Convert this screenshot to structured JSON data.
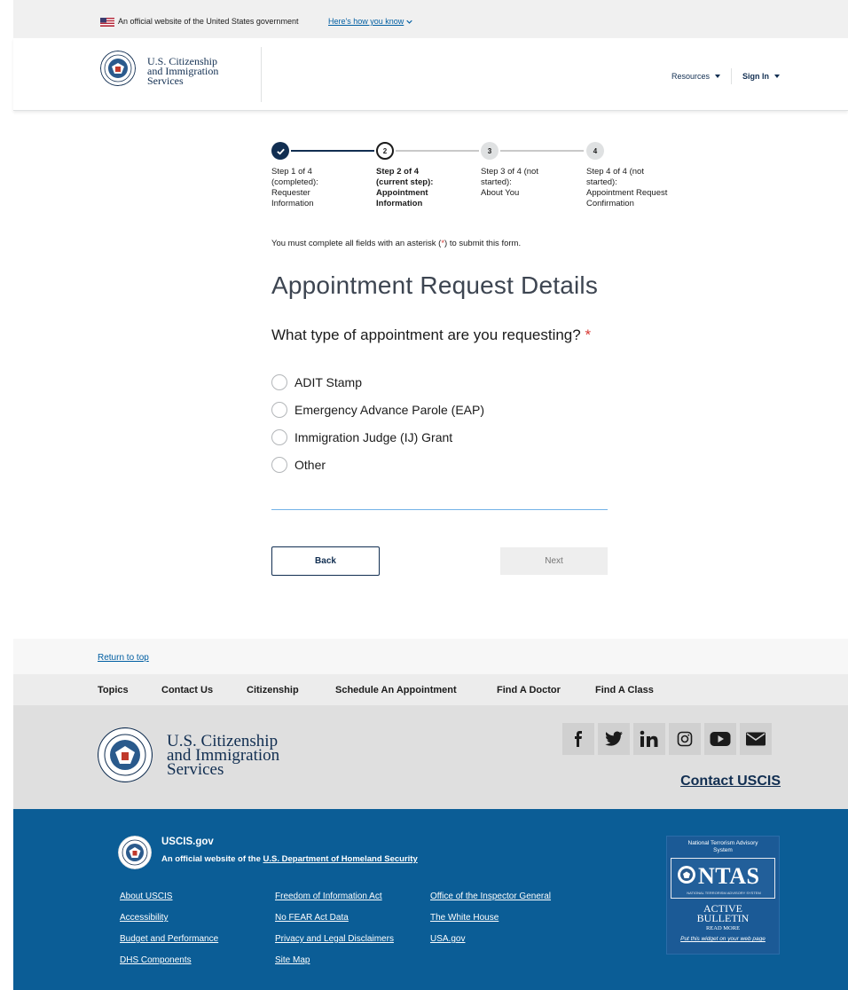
{
  "gov_banner": {
    "text": "An official website of the United States government",
    "link": "Here's how you know"
  },
  "header": {
    "agency_name_line1": "U.S. Citizenship",
    "agency_name_line2": "and Immigration",
    "agency_name_line3": "Services",
    "nav": {
      "resources": "Resources",
      "sign_in": "Sign In"
    }
  },
  "stepper": {
    "steps": [
      {
        "number": "1",
        "line1": "Step 1 of 4",
        "line2": "(completed):",
        "line3": "Requester",
        "line4": "Information",
        "state": "completed"
      },
      {
        "number": "2",
        "line1": "Step 2 of 4",
        "line2": "(current step):",
        "line3": "Appointment",
        "line4": "Information",
        "state": "current"
      },
      {
        "number": "3",
        "line1": "Step 3 of 4 (not",
        "line2": "started):",
        "line3": "About You",
        "line4": "",
        "state": "not-started"
      },
      {
        "number": "4",
        "line1": "Step 4 of 4 (not",
        "line2": "started):",
        "line3": "Appointment Request",
        "line4": "Confirmation",
        "state": "not-started"
      }
    ]
  },
  "form": {
    "required_note_before": "You must complete all fields with an asterisk (",
    "required_note_asterisk": "*",
    "required_note_after": ") to submit this form.",
    "title": "Appointment Request Details",
    "question": "What type of appointment are you requesting?",
    "question_asterisk": "*",
    "options": [
      "ADIT Stamp",
      "Emergency Advance Parole (EAP)",
      "Immigration Judge (IJ) Grant",
      "Other"
    ],
    "back_label": "Back",
    "next_label": "Next"
  },
  "footer": {
    "return_to_top": "Return to top",
    "topics": [
      "Topics",
      "Contact Us",
      "Citizenship",
      "Schedule An Appointment",
      "Find A Doctor",
      "Find A Class"
    ],
    "agency_name_line1": "U.S. Citizenship",
    "agency_name_line2": "and Immigration",
    "agency_name_line3": "Services",
    "social_icons": [
      "facebook-icon",
      "twitter-icon",
      "linkedin-icon",
      "instagram-icon",
      "youtube-icon",
      "email-icon"
    ],
    "contact_uscis": "Contact USCIS",
    "site_title": "USCIS.gov",
    "official_prefix": "An official website of the ",
    "official_link": "U.S. Department of Homeland Security",
    "links_col1": [
      "About USCIS",
      "Accessibility",
      "Budget and Performance",
      "DHS Components"
    ],
    "links_col2": [
      "Freedom of Information Act",
      "No FEAR Act Data",
      "Privacy and Legal Disclaimers",
      "Site Map"
    ],
    "links_col3": [
      "Office of the Inspector General",
      "The White House",
      "USA.gov"
    ],
    "ntas": {
      "top_line1": "National Terrorism Advisory",
      "top_line2": "System",
      "big": "NTAS",
      "small": "NATIONAL TERRORISM ADVISORY SYSTEM",
      "active_line1": "ACTIVE",
      "active_line2": "BULLETIN",
      "read_more": "READ MORE",
      "put": "Put this widget on your web page"
    }
  },
  "colors": {
    "brand_navy": "#112e51",
    "link_blue": "#005ea2",
    "footer_blue": "#0b5d96",
    "required_red": "#d83933"
  }
}
